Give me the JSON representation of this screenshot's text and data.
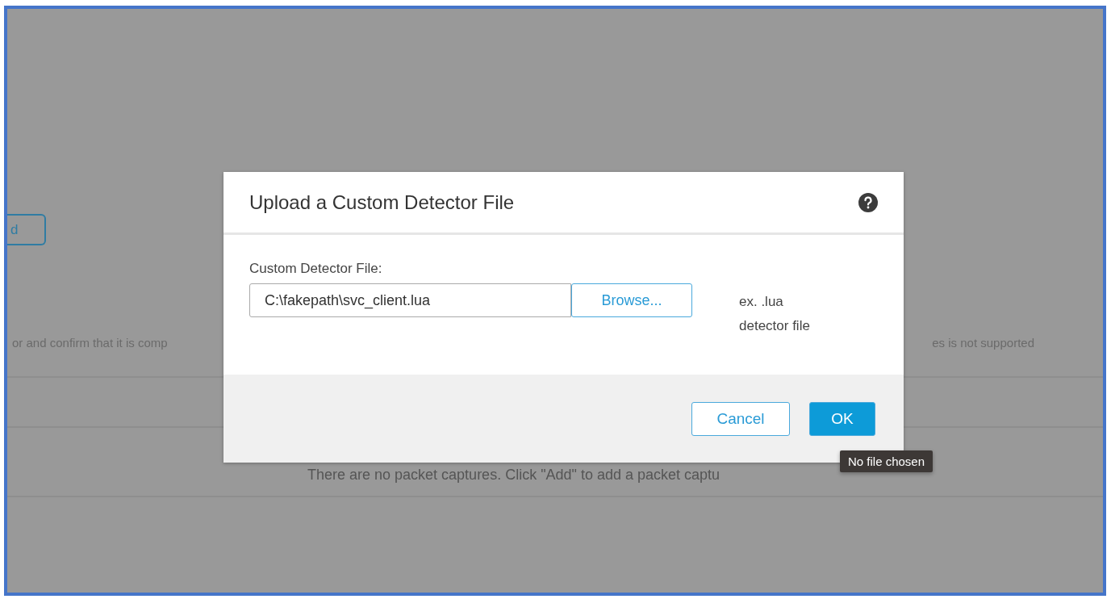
{
  "background": {
    "partial_button": "d",
    "left_text": "or and confirm that it is comp",
    "right_text": "es is not supported",
    "empty_message": "There are no packet captures. Click \"Add\" to add a packet captu"
  },
  "dialog": {
    "title": "Upload a Custom Detector File",
    "field_label": "Custom Detector File:",
    "file_path": "C:\\fakepath\\svc_client.lua",
    "browse_button": "Browse...",
    "hint": "ex. .lua detector file",
    "buttons": [
      {
        "label": "Cancel",
        "kind": "secondary"
      },
      {
        "label": "OK",
        "kind": "primary"
      }
    ]
  },
  "tooltip": "No file chosen"
}
